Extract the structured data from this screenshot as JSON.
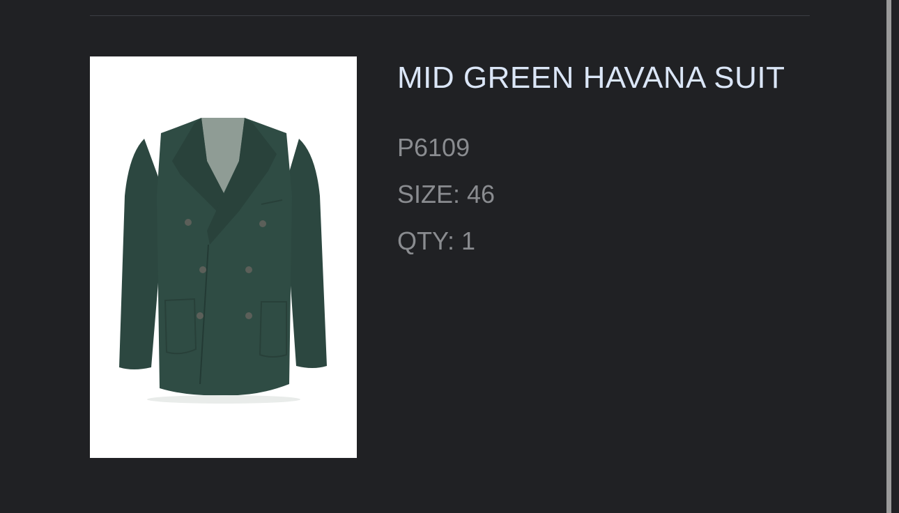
{
  "product": {
    "title": "MID GREEN HAVANA SUIT",
    "sku": "P6109",
    "size": "SIZE: 46",
    "qty": "QTY: 1",
    "image_subject": "double-breasted green suit jacket"
  },
  "colors": {
    "background": "#202124",
    "title": "#dbe6f7",
    "meta": "#8a8c90",
    "jacket": "#2f4c44"
  }
}
